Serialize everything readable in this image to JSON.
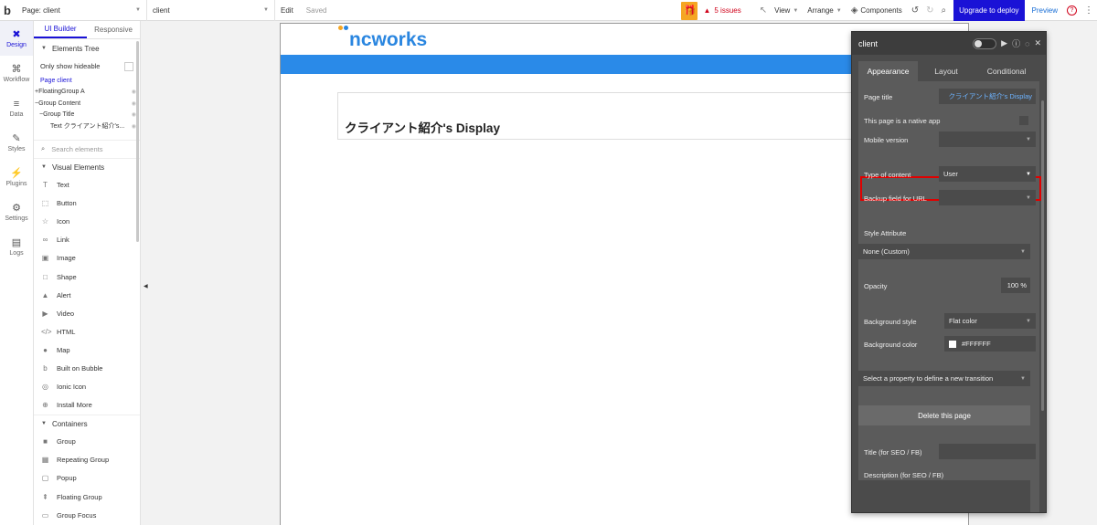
{
  "topbar": {
    "logo": "b",
    "page_select": "Page: client",
    "element_select": "client",
    "edit": "Edit",
    "saved": "Saved",
    "issues": "5 issues",
    "view": "View",
    "arrange": "Arrange",
    "components": "Components",
    "upgrade": "Upgrade to deploy",
    "preview": "Preview"
  },
  "leftnav": [
    {
      "label": "Design",
      "icon": "design-icon"
    },
    {
      "label": "Workflow",
      "icon": "workflow-icon"
    },
    {
      "label": "Data",
      "icon": "database-icon"
    },
    {
      "label": "Styles",
      "icon": "brush-icon"
    },
    {
      "label": "Plugins",
      "icon": "plug-icon"
    },
    {
      "label": "Settings",
      "icon": "gear-icon"
    },
    {
      "label": "Logs",
      "icon": "document-icon"
    }
  ],
  "leftpanel": {
    "tabs": [
      "UI Builder",
      "Responsive"
    ],
    "elements_tree": "Elements Tree",
    "only_show_hideable": "Only show hideable",
    "tree": {
      "page": "Page client",
      "floating_group": "FloatingGroup A",
      "group_content": "Group Content",
      "group_title": "Group Title",
      "text": "Text クライアント紹介's..."
    },
    "search_placeholder": "Search elements",
    "visual_elements": "Visual Elements",
    "visual_items": [
      "Text",
      "Button",
      "Icon",
      "Link",
      "Image",
      "Shape",
      "Alert",
      "Video",
      "HTML",
      "Map",
      "Built on Bubble",
      "Ionic Icon",
      "Install More"
    ],
    "containers": "Containers",
    "container_items": [
      "Group",
      "Repeating Group",
      "Popup",
      "Floating Group",
      "Group Focus"
    ]
  },
  "canvas": {
    "logo_text": "ncworks",
    "logo_dot_colors": [
      "#f5a623",
      "#2a86e0"
    ],
    "header_bar_color": "#2a8ae8",
    "content_title": "クライアント紹介's Display"
  },
  "property_editor": {
    "title": "client",
    "tabs": [
      "Appearance",
      "Layout",
      "Conditional"
    ],
    "page_title_label": "Page title",
    "page_title_value": "クライアント紹介's Display",
    "native_app_label": "This page is a native app",
    "mobile_version_label": "Mobile version",
    "type_of_content_label": "Type of content",
    "type_of_content_value": "User",
    "backup_field_label": "Backup field for URL",
    "style_attribute_label": "Style Attribute",
    "style_attribute_value": "None (Custom)",
    "opacity_label": "Opacity",
    "opacity_value": "100 %",
    "background_style_label": "Background style",
    "background_style_value": "Flat color",
    "background_color_label": "Background color",
    "background_color_value": "#FFFFFF",
    "transition_placeholder": "Select a property to define a new transition",
    "delete_button": "Delete this page",
    "seo_title_label": "Title (for SEO / FB)",
    "seo_description_label": "Description (for SEO / FB)",
    "highlight_color": "#e00000"
  }
}
